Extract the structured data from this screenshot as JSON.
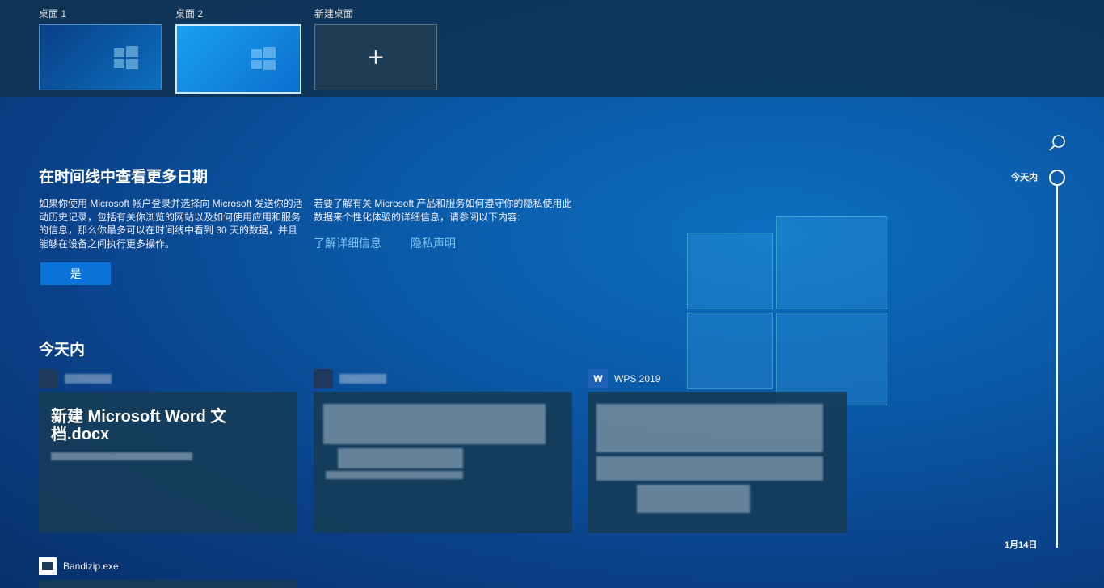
{
  "desktops": [
    {
      "label": "桌面 1"
    },
    {
      "label": "桌面 2"
    },
    {
      "label": "新建桌面"
    }
  ],
  "promo": {
    "title": "在时间线中查看更多日期",
    "left_text": "如果你使用 Microsoft 帐户登录并选择向 Microsoft 发送你的活动历史记录，包括有关你浏览的网站以及如何使用应用和服务的信息，那么你最多可以在时间线中看到 30 天的数据，并且能够在设备之间执行更多操作。",
    "right_text": "若要了解有关 Microsoft 产品和服务如何遵守你的隐私使用此数据来个性化体验的详细信息，请参阅以下内容:",
    "link_learn": "了解详细信息",
    "link_privacy": "隐私声明",
    "yes_button": "是"
  },
  "today": {
    "title": "今天内",
    "cards": [
      {
        "app": "",
        "title": "新建 Microsoft Word 文档.docx"
      },
      {
        "app": "",
        "title": ""
      },
      {
        "app": "WPS 2019",
        "title": ""
      }
    ],
    "next_app": "Bandizip.exe"
  },
  "timeline": {
    "top_label": "今天内",
    "bottom_label": "1月14日"
  },
  "colors": {
    "accent": "#0a72d8",
    "link": "#7fc3f2"
  }
}
